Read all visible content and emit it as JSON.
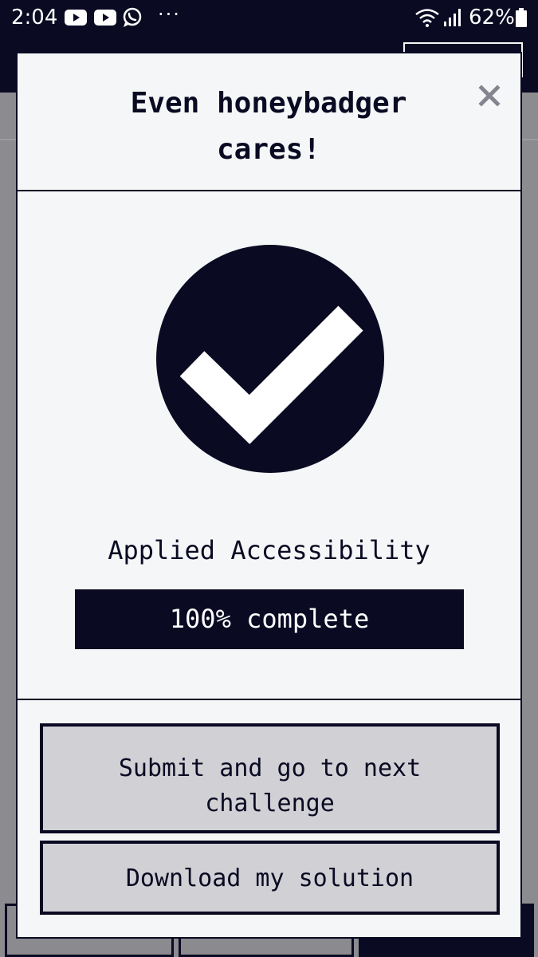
{
  "status_bar": {
    "time": "2:04",
    "notification_icons": [
      "youtube-icon",
      "youtube-icon",
      "whatsapp-icon",
      "more-dots-icon"
    ],
    "more_label": "···",
    "system_icons": [
      "wifi-icon",
      "signal-icon",
      "battery-icon"
    ],
    "battery": "62%"
  },
  "modal": {
    "title": "Even honeybadger cares!",
    "close_icon": "close-icon",
    "graphic_icon": "check-circle-icon",
    "course_name": "Applied Accessibility",
    "progress": {
      "percent": 100,
      "label": "100% complete"
    },
    "buttons": {
      "submit_label": "Submit and go to next challenge",
      "download_label": "Download my solution"
    }
  },
  "colors": {
    "primary": "#0a0a23",
    "modal_background": "#f5f6f7",
    "button_background": "#d0d0d5",
    "status_text": "#ffffff"
  }
}
